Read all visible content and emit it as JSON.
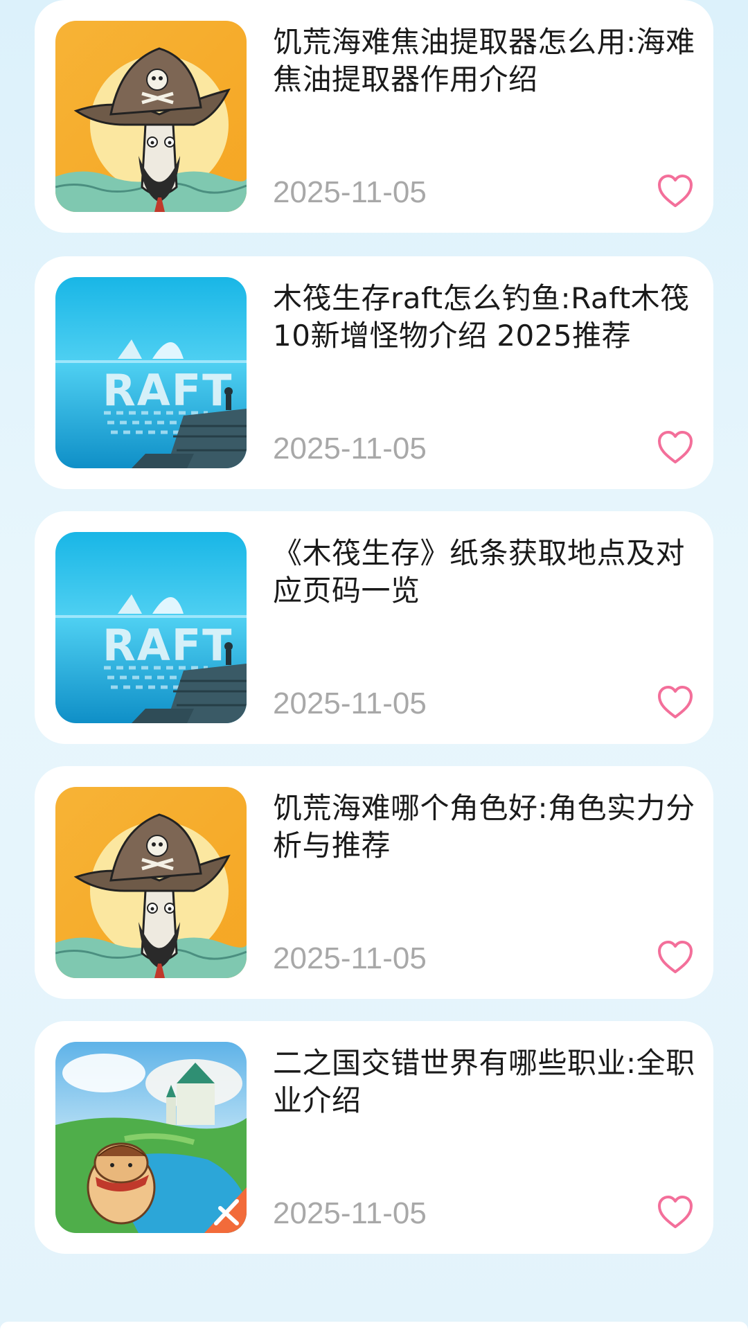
{
  "articles": [
    {
      "title": "饥荒海难焦油提取器怎么用:海难焦油提取器作用介绍",
      "date": "2025-11-05",
      "thumbnail": "shipwrecked-pirate-icon",
      "favorite_icon": "heart-outline-icon"
    },
    {
      "title": "木筏生存raft怎么钓鱼:Raft木筏10新增怪物介绍  2025推荐",
      "date": "2025-11-05",
      "thumbnail": "raft-icon",
      "favorite_icon": "heart-outline-icon"
    },
    {
      "title": "《木筏生存》纸条获取地点及对应页码一览",
      "date": "2025-11-05",
      "thumbnail": "raft-icon",
      "favorite_icon": "heart-outline-icon"
    },
    {
      "title": "饥荒海难哪个角色好:角色实力分析与推荐",
      "date": "2025-11-05",
      "thumbnail": "shipwrecked-pirate-icon",
      "favorite_icon": "heart-outline-icon"
    },
    {
      "title": "二之国交错世界有哪些职业:全职业介绍",
      "date": "2025-11-05",
      "thumbnail": "ni-no-kuni-icon",
      "favorite_icon": "heart-outline-icon"
    }
  ],
  "colors": {
    "heart": "#f36f9a",
    "date": "#a8a8a8",
    "title": "#1a1a1a"
  }
}
